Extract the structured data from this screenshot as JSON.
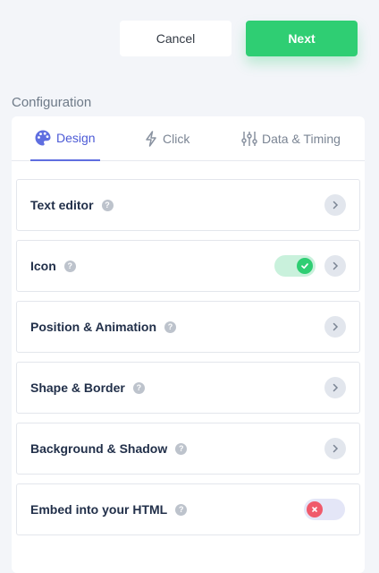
{
  "header": {
    "cancel_label": "Cancel",
    "next_label": "Next"
  },
  "section_title": "Configuration",
  "tabs": [
    {
      "label": "Design",
      "icon": "palette-icon",
      "active": true
    },
    {
      "label": "Click",
      "icon": "lightning-icon",
      "active": false
    },
    {
      "label": "Data & Timing",
      "icon": "sliders-icon",
      "active": false
    }
  ],
  "rows": [
    {
      "label": "Text editor",
      "control": "chevron"
    },
    {
      "label": "Icon",
      "control": "toggle-on+chevron"
    },
    {
      "label": "Position & Animation",
      "control": "chevron"
    },
    {
      "label": "Shape & Border",
      "control": "chevron"
    },
    {
      "label": "Background & Shadow",
      "control": "chevron"
    },
    {
      "label": "Embed into your HTML",
      "control": "toggle-off"
    }
  ],
  "help_glyph": "?",
  "colors": {
    "accent": "#4c5ad6",
    "primary_button": "#2fce73",
    "toggle_on": "#2fce73",
    "toggle_off": "#f05a6b",
    "background": "#f3f5f9"
  }
}
